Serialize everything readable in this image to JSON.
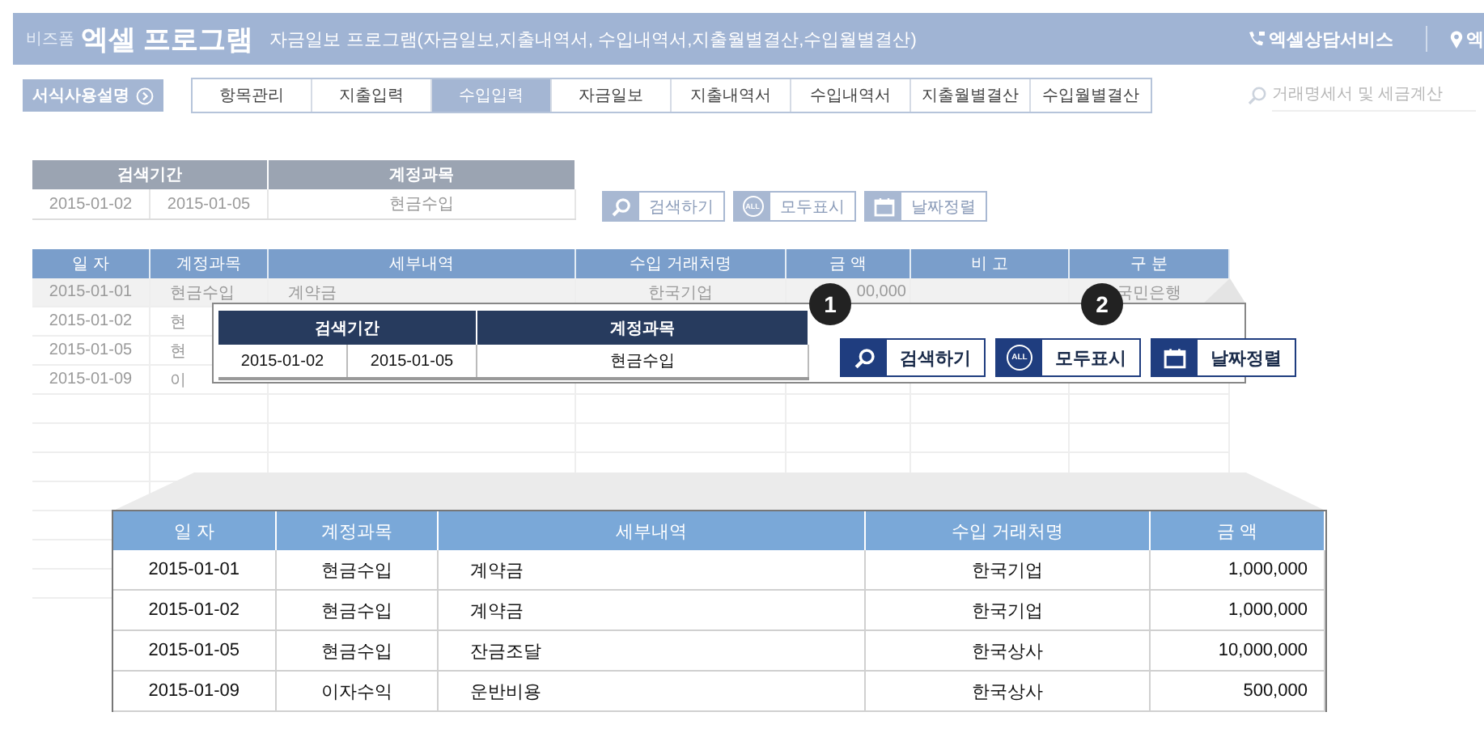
{
  "header": {
    "brand": "비즈폼",
    "title": "엑셀 프로그램",
    "subtitle": "자금일보 프로그램(자금일보,지출내역서, 수입내역서,지출월별결산,수입월별결산)",
    "links": [
      {
        "kind": "phone",
        "label": "엑셀상담서비스"
      },
      {
        "kind": "pin",
        "label": "엑"
      }
    ]
  },
  "guide_button": "서식사용설명",
  "tabs": [
    {
      "label": "항목관리",
      "selected": false
    },
    {
      "label": "지출입력",
      "selected": false
    },
    {
      "label": "수입입력",
      "selected": true
    },
    {
      "label": "자금일보",
      "selected": false
    },
    {
      "label": "지출내역서",
      "selected": false
    },
    {
      "label": "수입내역서",
      "selected": false
    },
    {
      "label": "지출월별결산",
      "selected": false
    },
    {
      "label": "수입월별결산",
      "selected": false
    }
  ],
  "search": {
    "placeholder": "거래명세서 및 세금계산"
  },
  "filter": {
    "columns": [
      "검색기간",
      "계정과목"
    ],
    "start": "2015-01-02",
    "end": "2015-01-05",
    "account": "현금수입"
  },
  "buttons": [
    {
      "kind": "search",
      "label": "검색하기"
    },
    {
      "kind": "all",
      "icon_text": "ALL",
      "label": "모두표시"
    },
    {
      "kind": "calendar",
      "label": "날짜정렬"
    }
  ],
  "table": {
    "columns": [
      "일 자",
      "계정과목",
      "세부내역",
      "수입 거래처명",
      "금 액",
      "비 고",
      "구 분"
    ],
    "rows": [
      [
        "2015-01-01",
        "현금수입",
        "계약금",
        "한국기업",
        "00,000",
        "",
        "국민은행"
      ],
      [
        "2015-01-02",
        "현"
      ],
      [
        "2015-01-05",
        "현"
      ],
      [
        "2015-01-09",
        "이"
      ]
    ]
  },
  "zoom_filter": {
    "columns": [
      "검색기간",
      "계정과목"
    ],
    "start": "2015-01-02",
    "end": "2015-01-05",
    "account": "현금수입",
    "badges": [
      "1",
      "2"
    ],
    "buttons": [
      {
        "kind": "search",
        "label": "검색하기"
      },
      {
        "kind": "all",
        "icon_text": "ALL",
        "label": "모두표시"
      },
      {
        "kind": "calendar",
        "label": "날짜정렬"
      }
    ]
  },
  "zoom_table": {
    "columns": [
      "일 자",
      "계정과목",
      "세부내역",
      "수입 거래처명",
      "금 액"
    ],
    "rows": [
      [
        "2015-01-01",
        "현금수입",
        "계약금",
        "한국기업",
        "1,000,000"
      ],
      [
        "2015-01-02",
        "현금수입",
        "계약금",
        "한국기업",
        "1,000,000"
      ],
      [
        "2015-01-05",
        "현금수입",
        "잔금조달",
        "한국상사",
        "10,000,000"
      ],
      [
        "2015-01-09",
        "이자수익",
        "운반비용",
        "한국상사",
        "500,000"
      ]
    ]
  }
}
